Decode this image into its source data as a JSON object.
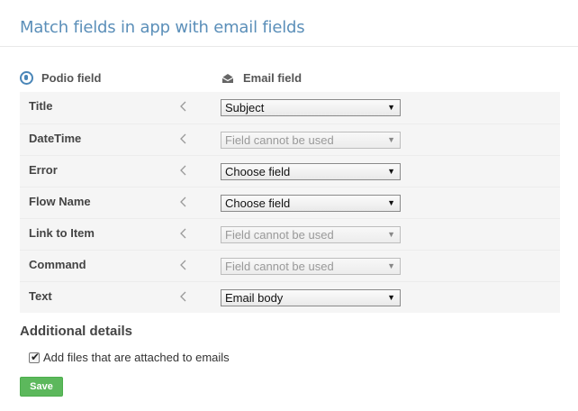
{
  "page": {
    "title": "Match fields in app with email fields"
  },
  "columns": {
    "podio_label": "Podio field",
    "email_label": "Email field",
    "podio_icon": "podio-logo-icon",
    "email_icon": "envelope-icon"
  },
  "rows": [
    {
      "label": "Title",
      "value": "Subject",
      "disabled": false
    },
    {
      "label": "DateTime",
      "value": "Field cannot be used",
      "disabled": true
    },
    {
      "label": "Error",
      "value": "Choose field",
      "disabled": false
    },
    {
      "label": "Flow Name",
      "value": "Choose field",
      "disabled": false
    },
    {
      "label": "Link to Item",
      "value": "Field cannot be used",
      "disabled": true
    },
    {
      "label": "Command",
      "value": "Field cannot be used",
      "disabled": true
    },
    {
      "label": "Text",
      "value": "Email body",
      "disabled": false
    }
  ],
  "additional": {
    "heading": "Additional details",
    "attach_label": "Add files that are attached to emails",
    "attach_checked": true
  },
  "save_label": "Save",
  "colors": {
    "title": "#5b8fb9",
    "save": "#5cb85c"
  }
}
